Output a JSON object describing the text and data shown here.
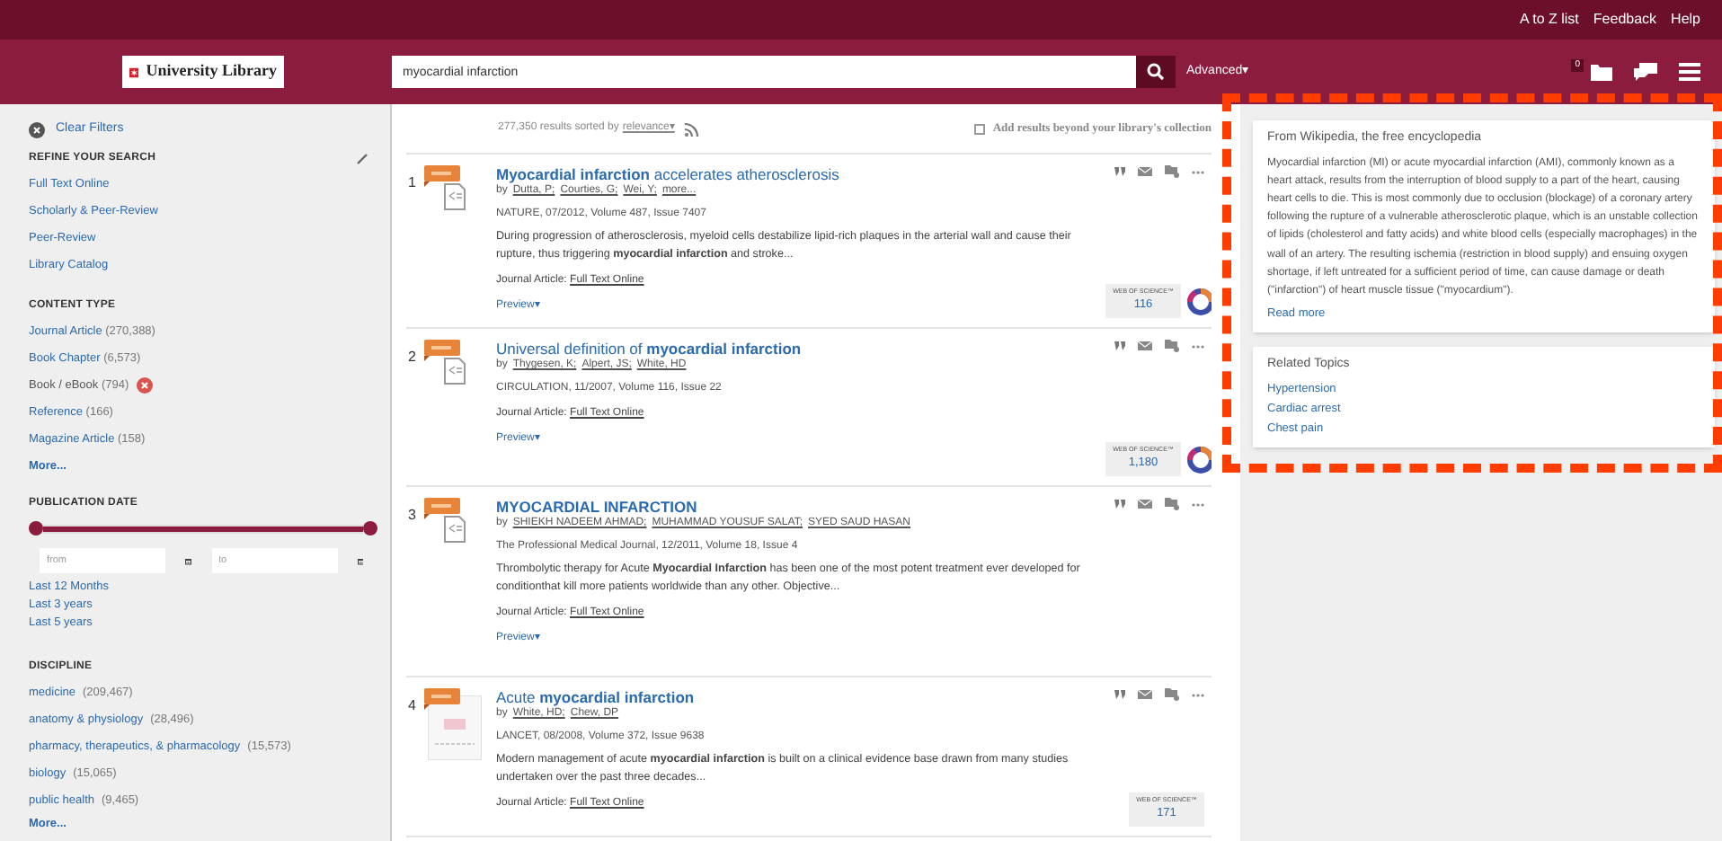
{
  "top_links": [
    "A to Z list",
    "Feedback",
    "Help"
  ],
  "header": {
    "logo": "University Library",
    "search_value": "myocardial infarction",
    "advanced": "Advanced▾",
    "folder_count": "0"
  },
  "sidebar": {
    "clear": "Clear Filters",
    "refine_title": "REFINE YOUR SEARCH",
    "refine": [
      "Full Text Online",
      "Scholarly & Peer-Review",
      "Peer-Review",
      "Library Catalog"
    ],
    "content_title": "CONTENT TYPE",
    "content": [
      {
        "label": "Journal Article",
        "count": "(270,388)",
        "selected": false
      },
      {
        "label": "Book Chapter",
        "count": "(6,573)",
        "selected": false
      },
      {
        "label": "Book / eBook",
        "count": "(794)",
        "selected": true
      },
      {
        "label": "Reference",
        "count": "(166)",
        "selected": false
      },
      {
        "label": "Magazine Article",
        "count": "(158)",
        "selected": false
      }
    ],
    "content_more": "More...",
    "date_title": "PUBLICATION DATE",
    "date_slider": {
      "level": 1
    },
    "from_placeholder": "from",
    "to_placeholder": "to",
    "date_links": [
      "Last 12 Months",
      "Last 3 years",
      "Last 5 years"
    ],
    "discipline_title": "DISCIPLINE",
    "disciplines": [
      {
        "label": "medicine",
        "count": "(209,467)"
      },
      {
        "label": "anatomy & physiology",
        "count": "(28,496)"
      },
      {
        "label": "pharmacy, therapeutics, & pharmacology",
        "count": "(15,573)"
      },
      {
        "label": "biology",
        "count": "(15,065)"
      },
      {
        "label": "public health",
        "count": "(9,465)"
      }
    ],
    "discipline_more": "More..."
  },
  "results_header": {
    "count": "277,350 results sorted by",
    "sort": "relevance▾",
    "beyond": {
      "label": "Add results beyond your library's collection",
      "checked": false
    }
  },
  "results": [
    {
      "number": "1",
      "kind": "document",
      "title": "**Myocardial infarction** accelerates atherosclerosis",
      "by": "by",
      "authors": [
        "Dutta, P;",
        "Courties, G;",
        "Wei, Y;"
      ],
      "more": "more...",
      "source": "NATURE, 07/2012, Volume 487, Issue 7407",
      "snippet": "During progression of atherosclerosis, myeloid cells destabilize lipid-rich plaques in the arterial wall and cause their rupture, thus triggering **myocardial infarction** and stroke...",
      "type": "Journal Article:",
      "link": "Full Text Online",
      "preview": "Preview▾",
      "wos": {
        "label": "WEB OF SCIENCE™",
        "count": "116"
      },
      "score_ring": true
    },
    {
      "number": "2",
      "kind": "document",
      "title": "Universal definition of **myocardial infarction**",
      "by": "by",
      "authors": [
        "Thygesen, K;",
        "Alpert, JS;",
        "White, HD"
      ],
      "source": "CIRCULATION, 11/2007, Volume 116, Issue 22",
      "type": "Journal Article:",
      "link": "Full Text Online",
      "preview": "Preview▾",
      "wos": {
        "label": "WEB OF SCIENCE™",
        "count": "1,180"
      },
      "score_ring": true
    },
    {
      "number": "3",
      "kind": "document",
      "title": "**MYOCARDIAL INFARCTION**",
      "by": "by",
      "authors": [
        "SHIEKH NADEEM AHMAD;",
        "MUHAMMAD YOUSUF SALAT;",
        "SYED SAUD HASAN"
      ],
      "source": "The Professional Medical Journal, 12/2011, Volume 18, Issue 4",
      "snippet": "Thrombolytic therapy for Acute **Myocardial Infarction** has been one of the most potent treatment ever developed for conditionthat kill more patients worldwide than any other. Objective...",
      "type": "Journal Article:",
      "link": "Full Text Online",
      "preview": "Preview▾",
      "score_ring": false
    },
    {
      "number": "4",
      "kind": "cover",
      "title": "Acute **myocardial infarction**",
      "by": "by",
      "authors": [
        "White, HD;",
        "Chew, DP"
      ],
      "source": "LANCET, 08/2008, Volume 372, Issue 9638",
      "snippet": "Modern management of acute **myocardial infarction** is built on a clinical evidence base drawn from many studies undertaken over the past three decades...",
      "type": "Journal Article:",
      "link": "Full Text Online",
      "wos": {
        "label": "WEB OF SCIENCE™",
        "count": "171"
      },
      "score_ring": false
    }
  ],
  "wikipedia": {
    "heading": "From Wikipedia, the free encyclopedia",
    "text": "Myocardial infarction (MI) or acute myocardial infarction (AMI), commonly known as a heart attack, results from the interruption of blood supply to a part of the heart, causing heart cells to die. This is most commonly due to occlusion (blockage) of a coronary artery following the rupture of a vulnerable atherosclerotic plaque, which is an unstable collection of lipids (cholesterol and fatty acids) and white blood cells (especially macrophages) in the wall of an artery. The resulting ischemia (restriction in blood supply) and ensuing oxygen shortage, if left untreated for a sufficient period of time, can cause damage or death (\"infarction\") of heart muscle tissue (\"myocardium\").",
    "read_more": "Read more"
  },
  "related": {
    "heading": "Related Topics",
    "topics": [
      "Hypertension",
      "Cardiac arrest",
      "Chest pain"
    ]
  }
}
